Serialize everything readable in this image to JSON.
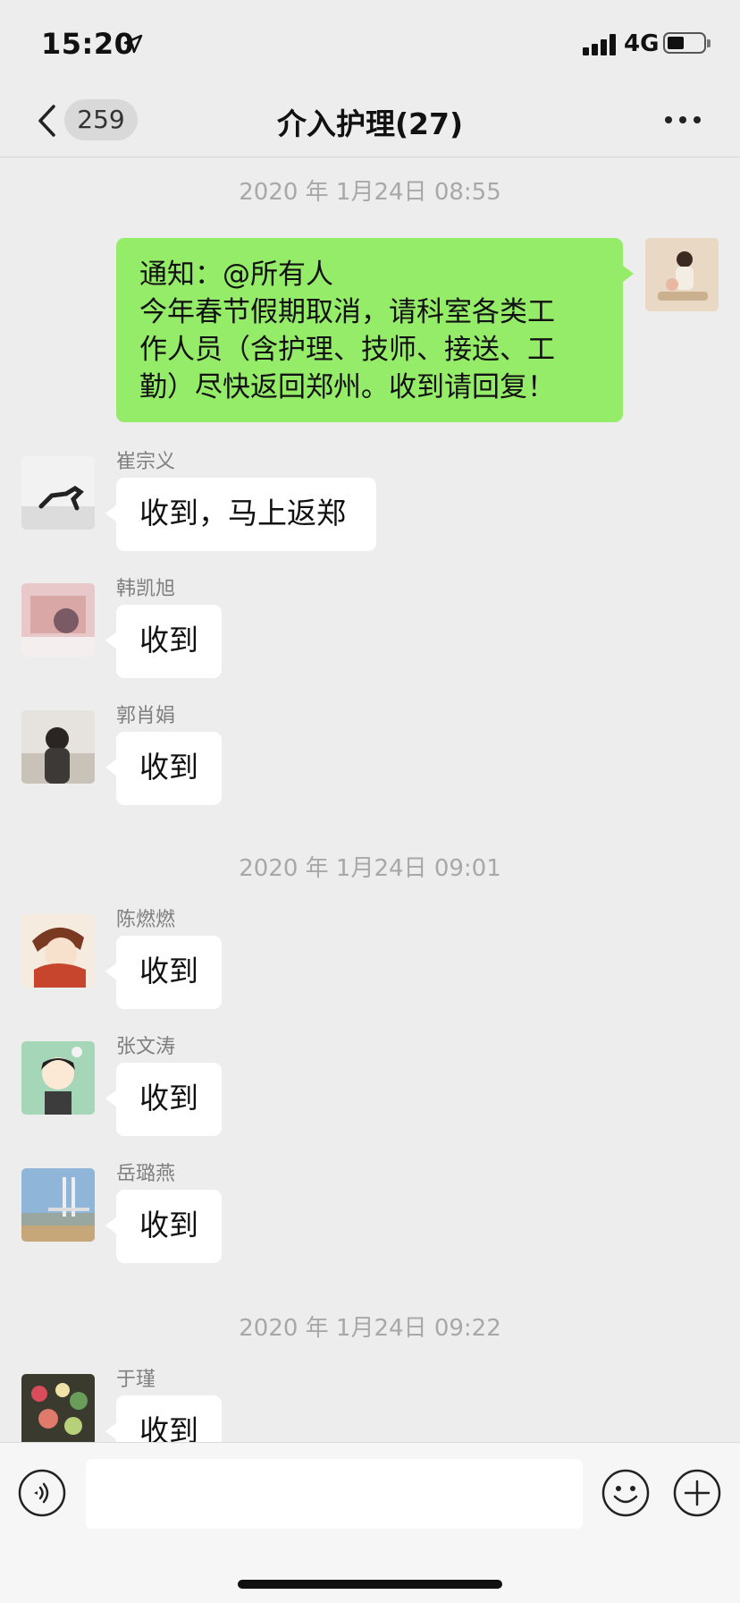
{
  "status_bar": {
    "time": "15:20",
    "network": "4G",
    "icons": [
      "location-arrow-icon",
      "signal-bars-icon",
      "battery-icon"
    ]
  },
  "nav": {
    "unread_count": "259",
    "title": "介入护理(27)",
    "icons": [
      "back-chevron-icon",
      "more-dots-icon"
    ]
  },
  "timestamps": [
    "2020 年 1月24日 08:55",
    "2020 年 1月24日 09:01",
    "2020 年 1月24日 09:22"
  ],
  "outgoing": {
    "lines": [
      "通知：@所有人",
      "今年春节假期取消，请科室各类工",
      "作人员（含护理、技师、接送、工",
      "勤）尽快返回郑州。收到请回复！"
    ]
  },
  "messages": [
    {
      "sender": "崔宗义",
      "text": "收到，马上返郑"
    },
    {
      "sender": "韩凯旭",
      "text": "收到"
    },
    {
      "sender": "郭肖娟",
      "text": "收到"
    },
    {
      "sender": "陈燃燃",
      "text": "收到"
    },
    {
      "sender": "张文涛",
      "text": "收到"
    },
    {
      "sender": "岳璐燕",
      "text": "收到"
    },
    {
      "sender": "于瑾",
      "text": "收到"
    }
  ],
  "input_bar": {
    "text_value": "",
    "icons": [
      "voice-icon",
      "emoji-icon",
      "plus-icon"
    ]
  },
  "colors": {
    "background": "#ededed",
    "outgoing_bubble": "#95ec69",
    "incoming_bubble": "#ffffff",
    "timestamp": "#a8a8a8",
    "sender_name": "#7f7f7f"
  }
}
